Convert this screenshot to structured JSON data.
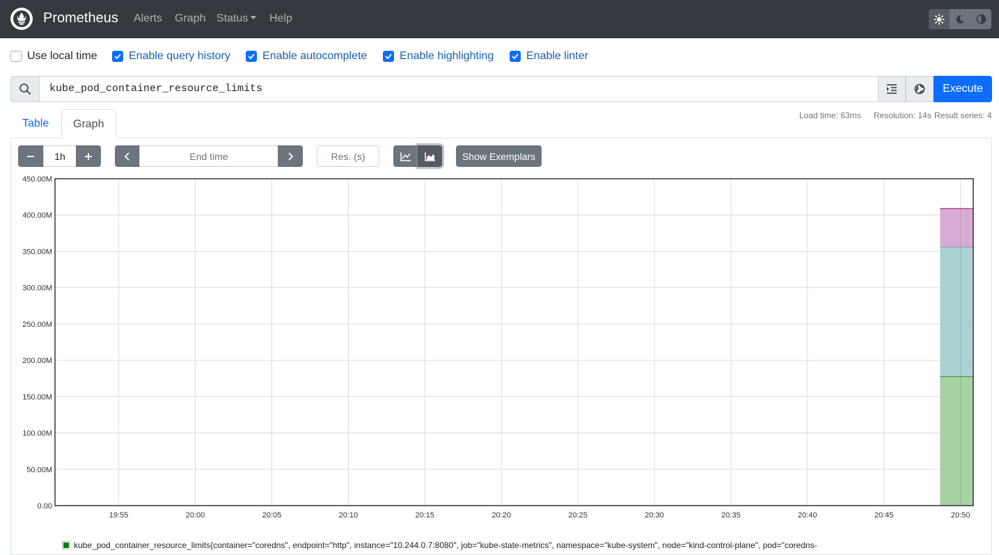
{
  "nav": {
    "brand": "Prometheus",
    "links": [
      "Alerts",
      "Graph",
      "Status",
      "Help"
    ]
  },
  "options": [
    {
      "label": "Use local time",
      "checked": false
    },
    {
      "label": "Enable query history",
      "checked": true
    },
    {
      "label": "Enable autocomplete",
      "checked": true
    },
    {
      "label": "Enable highlighting",
      "checked": true
    },
    {
      "label": "Enable linter",
      "checked": true
    }
  ],
  "query": {
    "expression": "kube_pod_container_resource_limits",
    "execute_label": "Execute"
  },
  "stats": {
    "load_time": "Load time: 63ms",
    "resolution": "Resolution: 14s",
    "result_series": "Result series: 4"
  },
  "tabs": [
    "Table",
    "Graph"
  ],
  "controls": {
    "range": "1h",
    "end_time_placeholder": "End time",
    "res_placeholder": "Res. (s)",
    "exemplars_label": "Show Exemplars"
  },
  "chart_data": {
    "type": "area",
    "stacked": true,
    "ylim": [
      0,
      450
    ],
    "y_ticks": [
      "0.00",
      "50.00M",
      "100.00M",
      "150.00M",
      "200.00M",
      "250.00M",
      "300.00M",
      "350.00M",
      "400.00M",
      "450.00M"
    ],
    "x_ticks": [
      "19:55",
      "20:00",
      "20:05",
      "20:10",
      "20:15",
      "20:20",
      "20:25",
      "20:30",
      "20:35",
      "20:40",
      "20:45",
      "20:50"
    ],
    "series": [
      {
        "color": "#a3cfa1",
        "line": "#008000",
        "start": "20:48:40",
        "value": 178
      },
      {
        "color": "#a7cfd0",
        "line": "#4d9ea0",
        "start": "20:48:40",
        "value": 178
      },
      {
        "color": "#d5a6d3",
        "line": "#a02060",
        "start": "20:48:40",
        "value": 53
      }
    ],
    "legend_text": "kube_pod_container_resource_limits{container=\"coredns\", endpoint=\"http\", instance=\"10.244.0.7:8080\", job=\"kube-state-metrics\", namespace=\"kube-system\", node=\"kind-control-plane\", pod=\"coredns-"
  }
}
